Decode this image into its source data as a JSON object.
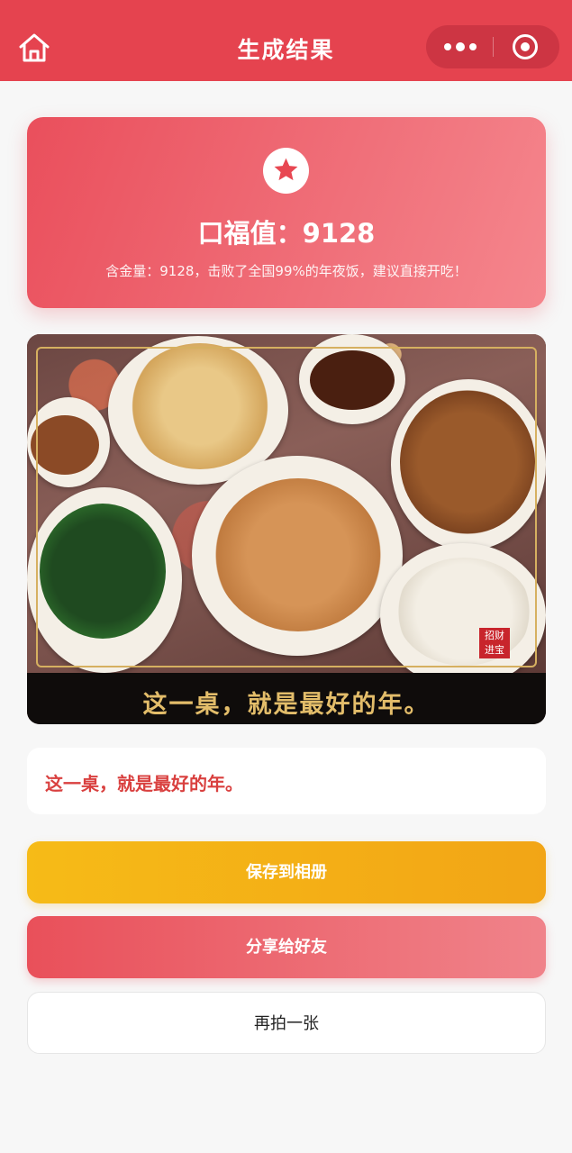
{
  "nav": {
    "title": "生成结果",
    "home_icon": "home-icon",
    "more_icon": "more-dots-icon",
    "close_icon": "target-close-icon",
    "bar_color": "#e5434f"
  },
  "score_card": {
    "icon": "star-icon",
    "score_label": "口福值：",
    "score_value": "9128",
    "description": "含金量：9128，击败了全国99%的年夜饭，建议直接开吃！"
  },
  "photo": {
    "caption_overlay": "这一桌，就是最好的年。",
    "seal_text": "招财进宝"
  },
  "caption": {
    "text": "这一桌，就是最好的年。"
  },
  "actions": {
    "save_label": "保存到相册",
    "share_label": "分享给好友",
    "retake_label": "再拍一张"
  },
  "colors": {
    "primary_red": "#e5434f",
    "gold": "#f6bb17",
    "caption_red": "#d9403f"
  }
}
